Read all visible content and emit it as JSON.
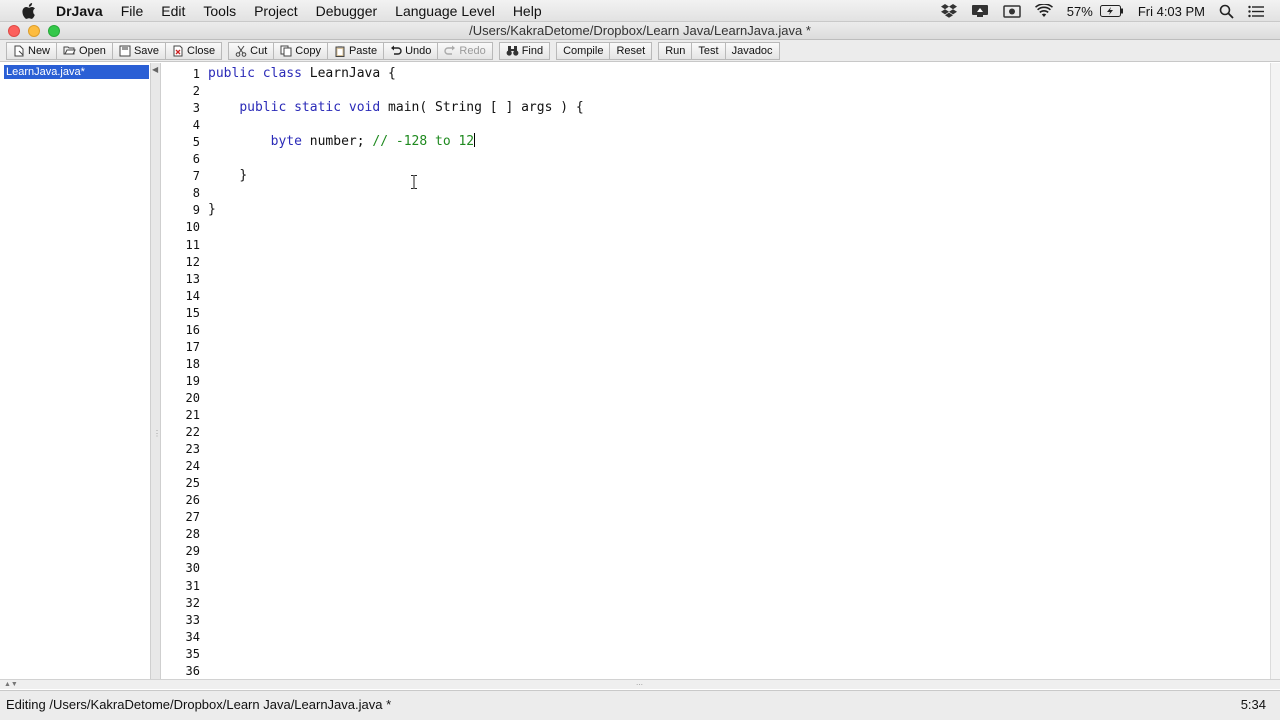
{
  "menubar": {
    "app_name": "DrJava",
    "items": [
      "File",
      "Edit",
      "Tools",
      "Project",
      "Debugger",
      "Language Level",
      "Help"
    ],
    "status": {
      "battery": "57%",
      "clock": "Fri 4:03 PM"
    },
    "icons": [
      "apple-icon",
      "dropbox-icon",
      "screen-share-icon",
      "camera-icon",
      "wifi-icon",
      "battery-icon",
      "search-icon",
      "list-icon"
    ]
  },
  "window": {
    "title": "/Users/KakraDetome/Dropbox/Learn Java/LearnJava.java *"
  },
  "toolbar": {
    "new": "New",
    "open": "Open",
    "save": "Save",
    "close": "Close",
    "cut": "Cut",
    "copy": "Copy",
    "paste": "Paste",
    "undo": "Undo",
    "redo": "Redo",
    "find": "Find",
    "compile": "Compile",
    "reset": "Reset",
    "run": "Run",
    "test": "Test",
    "javadoc": "Javadoc"
  },
  "files": {
    "open_file": "LearnJava.java*"
  },
  "editor": {
    "line_numbers": [
      "1",
      "2",
      "3",
      "4",
      "5",
      "6",
      "7",
      "8",
      "9",
      "10",
      "11",
      "12",
      "13",
      "14",
      "15",
      "16",
      "17",
      "18",
      "19",
      "20",
      "21",
      "22",
      "23",
      "24",
      "25",
      "26",
      "27",
      "28",
      "29",
      "30",
      "31",
      "32",
      "33",
      "34",
      "35",
      "36"
    ],
    "line1": {
      "kw1": "public",
      "kw2": "class",
      "rest": " LearnJava {"
    },
    "line3": {
      "kw1": "public",
      "kw2": "static",
      "kw3": "void",
      "rest": " main( String [ ] args ) {"
    },
    "line5": {
      "kw": "byte",
      "rest": " number; ",
      "comment": "// -128 to 12"
    },
    "line7": "}",
    "line9": "}"
  },
  "statusbar": {
    "message": "Editing /Users/KakraDetome/Dropbox/Learn Java/LearnJava.java *",
    "cursor_position": "5:34"
  },
  "colors": {
    "keyword": "#2b2bb8",
    "comment": "#1f8a1f",
    "selection": "#2a5fd5"
  }
}
